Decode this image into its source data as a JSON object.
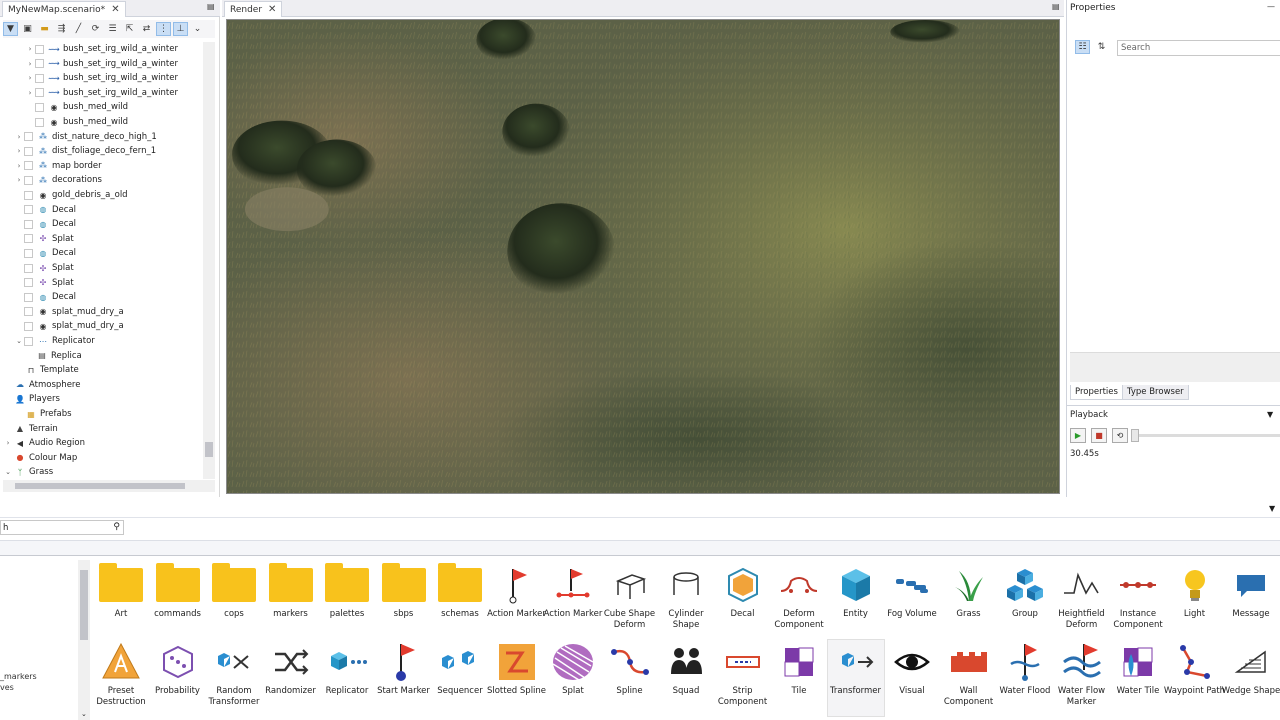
{
  "tabs": {
    "scenario": "MyNewMap.scenario*",
    "render": "Render"
  },
  "scenario_tree": [
    {
      "label": "bush_set_irg_wild_a_winter",
      "indent": 2,
      "twisty": "›",
      "icon": "spline-icon",
      "check": true
    },
    {
      "label": "bush_set_irg_wild_a_winter",
      "indent": 2,
      "twisty": "›",
      "icon": "spline-icon",
      "check": true
    },
    {
      "label": "bush_set_irg_wild_a_winter",
      "indent": 2,
      "twisty": "›",
      "icon": "spline-icon",
      "check": true
    },
    {
      "label": "bush_set_irg_wild_a_winter",
      "indent": 2,
      "twisty": "›",
      "icon": "spline-icon",
      "check": true
    },
    {
      "label": "bush_med_wild",
      "indent": 2,
      "twisty": "",
      "icon": "entity-icon",
      "check": true
    },
    {
      "label": "bush_med_wild",
      "indent": 2,
      "twisty": "",
      "icon": "entity-icon",
      "check": true
    },
    {
      "label": "dist_nature_deco_high_1",
      "indent": 1,
      "twisty": "›",
      "icon": "group-icon",
      "check": true
    },
    {
      "label": "dist_foliage_deco_fern_1",
      "indent": 1,
      "twisty": "›",
      "icon": "group-icon",
      "check": true
    },
    {
      "label": "map border",
      "indent": 1,
      "twisty": "›",
      "icon": "group-icon",
      "check": true
    },
    {
      "label": "decorations",
      "indent": 1,
      "twisty": "›",
      "icon": "group-icon",
      "check": true
    },
    {
      "label": "gold_debris_a_old",
      "indent": 1,
      "twisty": "",
      "icon": "entity-icon",
      "check": true
    },
    {
      "label": "Decal",
      "indent": 1,
      "twisty": "",
      "icon": "decal-icon",
      "check": true
    },
    {
      "label": "Decal",
      "indent": 1,
      "twisty": "",
      "icon": "decal-icon",
      "check": true
    },
    {
      "label": "Splat",
      "indent": 1,
      "twisty": "",
      "icon": "splat-icon",
      "check": true
    },
    {
      "label": "Decal",
      "indent": 1,
      "twisty": "",
      "icon": "decal-icon",
      "check": true
    },
    {
      "label": "Splat",
      "indent": 1,
      "twisty": "",
      "icon": "splat-icon",
      "check": true
    },
    {
      "label": "Splat",
      "indent": 1,
      "twisty": "",
      "icon": "splat-icon",
      "check": true
    },
    {
      "label": "Decal",
      "indent": 1,
      "twisty": "",
      "icon": "decal-icon",
      "check": true
    },
    {
      "label": "splat_mud_dry_a",
      "indent": 1,
      "twisty": "",
      "icon": "entity-icon",
      "check": true
    },
    {
      "label": "splat_mud_dry_a",
      "indent": 1,
      "twisty": "",
      "icon": "entity-icon",
      "check": true
    },
    {
      "label": "Replicator",
      "indent": 1,
      "twisty": "⌄",
      "icon": "replicator-icon",
      "check": true
    },
    {
      "label": "Replica",
      "indent": 2,
      "twisty": "",
      "icon": "replica-icon",
      "check": false
    },
    {
      "label": "Template",
      "indent": 1,
      "twisty": "",
      "icon": "template-icon",
      "check": false
    },
    {
      "label": "Atmosphere",
      "indent": 0,
      "twisty": "",
      "icon": "atmosphere-icon",
      "check": false
    },
    {
      "label": "Players",
      "indent": 0,
      "twisty": "",
      "icon": "players-icon",
      "check": false
    },
    {
      "label": "Prefabs",
      "indent": 1,
      "twisty": "",
      "icon": "prefab-icon",
      "check": false
    },
    {
      "label": "Terrain",
      "indent": 0,
      "twisty": "",
      "icon": "terrain-icon",
      "check": false
    },
    {
      "label": "Audio Region",
      "indent": 0,
      "twisty": "›",
      "icon": "audio-icon",
      "check": false
    },
    {
      "label": "Colour Map",
      "indent": 0,
      "twisty": "",
      "icon": "colour-map-icon",
      "check": false
    },
    {
      "label": "Grass",
      "indent": 0,
      "twisty": "⌄",
      "icon": "grass-icon",
      "check": false
    }
  ],
  "properties": {
    "title": "Properties",
    "search_placeholder": "Search",
    "tab_properties": "Properties",
    "tab_type_browser": "Type Browser"
  },
  "playback": {
    "title": "Playback",
    "time": "30.45s"
  },
  "palette": {
    "filter_text": "h",
    "left_list": [
      "_markers",
      "ves"
    ],
    "row1": [
      {
        "label": "Art",
        "icon": "folder-icon"
      },
      {
        "label": "commands",
        "icon": "folder-icon"
      },
      {
        "label": "cops",
        "icon": "folder-icon"
      },
      {
        "label": "markers",
        "icon": "folder-icon"
      },
      {
        "label": "palettes",
        "icon": "folder-icon"
      },
      {
        "label": "sbps",
        "icon": "folder-icon"
      },
      {
        "label": "schemas",
        "icon": "folder-icon"
      },
      {
        "label": "Action Marker",
        "icon": "action-marker-icon"
      },
      {
        "label": "Action Marker",
        "icon": "action-marker-path-icon"
      },
      {
        "label": "Cube Shape Deform",
        "icon": "cube-shape-deform-icon"
      },
      {
        "label": "Cylinder Shape",
        "icon": "cylinder-shape-icon"
      },
      {
        "label": "Decal",
        "icon": "decal-icon"
      },
      {
        "label": "Deform Component",
        "icon": "deform-component-icon"
      },
      {
        "label": "Entity",
        "icon": "entity-icon"
      },
      {
        "label": "Fog Volume",
        "icon": "fog-volume-icon"
      },
      {
        "label": "Grass",
        "icon": "grass-icon"
      },
      {
        "label": "Group",
        "icon": "group-icon"
      },
      {
        "label": "Heightfield Deform",
        "icon": "heightfield-deform-icon"
      },
      {
        "label": "Instance Component",
        "icon": "instance-component-icon"
      },
      {
        "label": "Light",
        "icon": "light-icon"
      },
      {
        "label": "Message",
        "icon": "message-icon"
      }
    ],
    "row2": [
      {
        "label": "Preset Destruction",
        "icon": "preset-destruction-icon"
      },
      {
        "label": "Probability",
        "icon": "probability-icon"
      },
      {
        "label": "Random Transformer",
        "icon": "random-transformer-icon"
      },
      {
        "label": "Randomizer",
        "icon": "randomizer-icon"
      },
      {
        "label": "Replicator",
        "icon": "replicator-icon"
      },
      {
        "label": "Start Marker",
        "icon": "start-marker-icon"
      },
      {
        "label": "Sequencer",
        "icon": "sequencer-icon"
      },
      {
        "label": "Slotted Spline",
        "icon": "slotted-spline-icon"
      },
      {
        "label": "Splat",
        "icon": "splat-icon"
      },
      {
        "label": "Spline",
        "icon": "spline-icon"
      },
      {
        "label": "Squad",
        "icon": "squad-icon"
      },
      {
        "label": "Strip Component",
        "icon": "strip-component-icon"
      },
      {
        "label": "Tile",
        "icon": "tile-icon"
      },
      {
        "label": "Transformer",
        "icon": "transformer-icon"
      },
      {
        "label": "Visual",
        "icon": "visual-icon"
      },
      {
        "label": "Wall Component",
        "icon": "wall-component-icon"
      },
      {
        "label": "Water Flood",
        "icon": "water-flood-icon"
      },
      {
        "label": "Water Flow Marker",
        "icon": "water-flow-marker-icon"
      },
      {
        "label": "Water Tile",
        "icon": "water-tile-icon"
      },
      {
        "label": "Waypoint Path",
        "icon": "waypoint-path-icon"
      },
      {
        "label": "Wedge Shape",
        "icon": "wedge-shape-icon"
      }
    ]
  }
}
